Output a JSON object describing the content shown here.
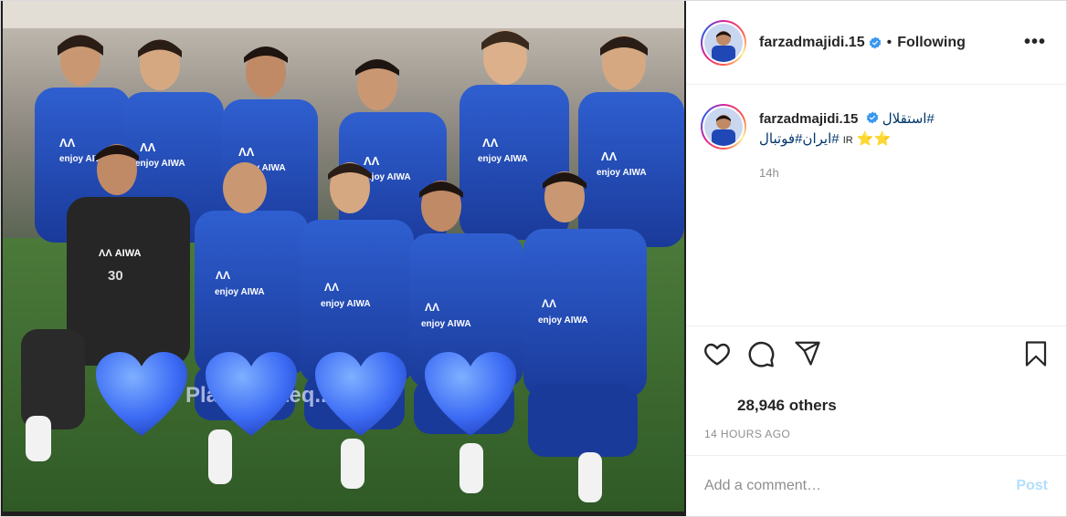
{
  "post": {
    "username": "farzadmajidi.15",
    "separator": "•",
    "follow_status": "Following",
    "more_label": "•••",
    "caption": {
      "username": "farzadmajidi.15",
      "hashtag_1": "#استقلال",
      "hashtag_2": "#ایران#فوتبال",
      "flag_text": "IR",
      "stars": "⭐⭐"
    },
    "caption_age": "14h",
    "likes_text": "28,946 others",
    "timestamp": "14 HOURS AGO",
    "comment_placeholder": "Add a comment…",
    "post_label": "Post",
    "image_overlay_hearts": "💙💙💙💙"
  },
  "icons": {
    "like": "heart-icon",
    "comment": "comment-icon",
    "share": "share-icon",
    "save": "bookmark-icon",
    "verified": "verified-badge-icon",
    "more": "more-options-icon"
  },
  "colors": {
    "verified_blue": "#3897f0",
    "hashtag": "#00376b",
    "post_button": "#b2dffc",
    "jersey_blue": "#1f47b5",
    "heart_blue": "#3d6cf5"
  }
}
